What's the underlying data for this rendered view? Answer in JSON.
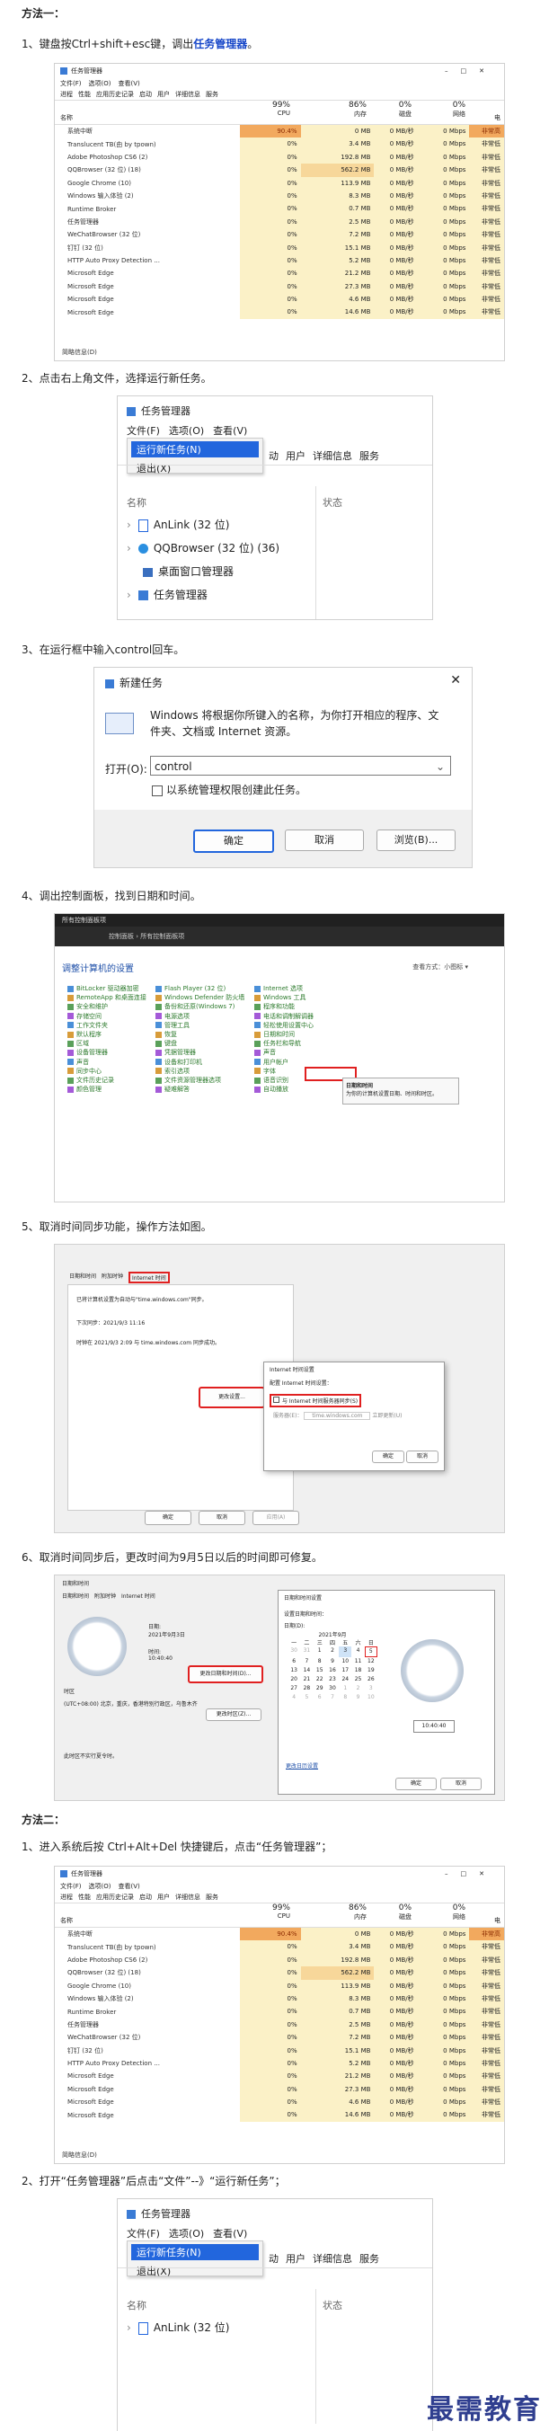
{
  "method1_title": "方法一：",
  "step1": {
    "prefix": "1、键盘按Ctrl+shift+esc键，调出",
    "highlight": "任务管理器",
    "suffix": "。"
  },
  "taskmgr": {
    "title": "任务管理器",
    "menu": [
      "文件(F)",
      "选项(O)",
      "查看(V)"
    ],
    "tabs": [
      "进程",
      "性能",
      "应用历史记录",
      "启动",
      "用户",
      "详细信息",
      "服务"
    ],
    "headers": {
      "name": "名称",
      "status": "状态",
      "cpu": "99%",
      "cpu_label": "CPU",
      "mem": "86%",
      "mem_label": "内存",
      "disk": "0%",
      "disk_label": "磁盘",
      "net": "0%",
      "net_label": "网络",
      "power_label": "电"
    },
    "rows": [
      {
        "name": "系统中断",
        "cpu": "90.4%",
        "mem": "0 MB",
        "disk": "0 MB/秒",
        "net": "0 Mbps",
        "power": "非常高",
        "hot": true
      },
      {
        "name": "Translucent TB(由 by tpown)",
        "cpu": "0%",
        "mem": "3.4 MB",
        "disk": "0 MB/秒",
        "net": "0 Mbps",
        "power": "非常低"
      },
      {
        "name": "Adobe Photoshop CS6 (2)",
        "cpu": "0%",
        "mem": "192.8 MB",
        "disk": "0 MB/秒",
        "net": "0 Mbps",
        "power": "非常低"
      },
      {
        "name": "QQBrowser (32 位) (18)",
        "cpu": "0%",
        "mem": "562.2 MB",
        "disk": "0 MB/秒",
        "net": "0 Mbps",
        "power": "非常低",
        "warm": true
      },
      {
        "name": "Google Chrome (10)",
        "cpu": "0%",
        "mem": "113.9 MB",
        "disk": "0 MB/秒",
        "net": "0 Mbps",
        "power": "非常低"
      },
      {
        "name": "Windows 输入体验 (2)",
        "cpu": "0%",
        "mem": "8.3 MB",
        "disk": "0 MB/秒",
        "net": "0 Mbps",
        "power": "非常低"
      },
      {
        "name": "Runtime Broker",
        "cpu": "0%",
        "mem": "0.7 MB",
        "disk": "0 MB/秒",
        "net": "0 Mbps",
        "power": "非常低"
      },
      {
        "name": "任务管理器",
        "cpu": "0%",
        "mem": "2.5 MB",
        "disk": "0 MB/秒",
        "net": "0 Mbps",
        "power": "非常低"
      },
      {
        "name": "WeChatBrowser (32 位)",
        "cpu": "0%",
        "mem": "7.2 MB",
        "disk": "0 MB/秒",
        "net": "0 Mbps",
        "power": "非常低"
      },
      {
        "name": "钉钉 (32 位)",
        "cpu": "0%",
        "mem": "15.1 MB",
        "disk": "0 MB/秒",
        "net": "0 Mbps",
        "power": "非常低"
      },
      {
        "name": "HTTP Auto Proxy Detection ...",
        "cpu": "0%",
        "mem": "5.2 MB",
        "disk": "0 MB/秒",
        "net": "0 Mbps",
        "power": "非常低"
      },
      {
        "name": "Microsoft Edge",
        "cpu": "0%",
        "mem": "21.2 MB",
        "disk": "0 MB/秒",
        "net": "0 Mbps",
        "power": "非常低"
      },
      {
        "name": "Microsoft Edge",
        "cpu": "0%",
        "mem": "27.3 MB",
        "disk": "0 MB/秒",
        "net": "0 Mbps",
        "power": "非常低"
      },
      {
        "name": "Microsoft Edge",
        "cpu": "0%",
        "mem": "4.6 MB",
        "disk": "0 MB/秒",
        "net": "0 Mbps",
        "power": "非常低"
      },
      {
        "name": "Microsoft Edge",
        "cpu": "0%",
        "mem": "14.6 MB",
        "disk": "0 MB/秒",
        "net": "0 Mbps",
        "power": "非常低"
      }
    ],
    "footer": "简略信息(D)"
  },
  "step2": "2、点击右上角文件，选择运行新任务。",
  "filemenu": {
    "title": "任务管理器",
    "menu": [
      "文件(F)",
      "选项(O)",
      "查看(V)"
    ],
    "run_new": "运行新任务(N)",
    "exit": "退出(X)",
    "tabs_tail": [
      "动",
      "用户",
      "详细信息",
      "服务"
    ],
    "col_name": "名称",
    "col_status": "状态",
    "items": [
      "AnLink (32 位)",
      "QQBrowser (32 位) (36)",
      "桌面窗口管理器",
      "任务管理器"
    ]
  },
  "step3": "3、在运行框中输入control回车。",
  "run": {
    "title": "新建任务",
    "desc_line1": "Windows 将根据你所键入的名称，为你打开相应的程序、文",
    "desc_line2": "件夹、文档或 Internet 资源。",
    "open_label": "打开(O):",
    "input_value": "control",
    "checkbox": "以系统管理权限创建此任务。",
    "ok": "确定",
    "cancel": "取消",
    "browse": "浏览(B)..."
  },
  "step4": "4、调出控制面板，找到日期和时间。",
  "cpanel": {
    "title": "所有控制面板项",
    "address": "控制面板 › 所有控制面板项",
    "heading": "调整计算机的设置",
    "view": "查看方式：小图标 ▾",
    "col1": [
      "BitLocker 驱动器加密",
      "RemoteApp 和桌面连接",
      "安全和维护",
      "存储空间",
      "工作文件夹",
      "默认程序",
      "区域",
      "设备管理器",
      "声音",
      "同步中心",
      "文件历史记录",
      "颜色管理"
    ],
    "col2": [
      "Flash Player (32 位)",
      "Windows Defender 防火墙",
      "备份和还原(Windows 7)",
      "电源选项",
      "管理工具",
      "恢复",
      "键盘",
      "凭据管理器",
      "设备和打印机",
      "索引选项",
      "文件资源管理器选项",
      "疑难解答"
    ],
    "col3": [
      "Internet 选项",
      "Windows 工具",
      "程序和功能",
      "电话和调制解调器",
      "轻松使用设置中心",
      "日期和时间",
      "任务栏和导航",
      "声音",
      "用户帐户",
      "字体",
      "语音识别",
      "自动播放"
    ],
    "tooltip_title": "日期和时间",
    "tooltip_desc": "为你的计算机设置日期、时间和时区。"
  },
  "step5": "5、取消时间同步功能，操作方法如图。",
  "inet": {
    "tabs": [
      "日期和时间",
      "附加时钟",
      "Internet 时间"
    ],
    "line1": "已将计算机设置为自动与\"time.windows.com\"同步。",
    "line2": "下次同步：2021/9/3 11:16",
    "line3": "时钟在 2021/9/3 2:09 与 time.windows.com 同步成功。",
    "change_btn": "更改设置...",
    "ok": "确定",
    "cancel": "取消",
    "apply": "应用(A)",
    "sub_title": "Internet 时间设置",
    "sub_heading": "配置 Internet 时间设置：",
    "sub_check": "与 Internet 时间服务器同步(S)",
    "sub_server_label": "服务器(E)：",
    "sub_server": "time.windows.com",
    "sub_update": "立即更新(U)",
    "sub_ok": "确定",
    "sub_cancel": "取消"
  },
  "step6": "6、取消时间同步后，更改时间为9月5日以后的时间即可修复。",
  "datetime": {
    "title": "日期和时间",
    "tabs": [
      "日期和时间",
      "附加时钟",
      "Internet 时间"
    ],
    "date_label": "日期:",
    "date": "2021年9月3日",
    "time_label": "时间:",
    "time": "10:40:40",
    "change_btn": "更改日期和时间(D)...",
    "tz_label": "时区",
    "tz": "(UTC+08:00) 北京，重庆，香港特别行政区，乌鲁木齐",
    "tz_btn": "更改时区(Z)...",
    "dst": "此时区不实行夏令时。",
    "sub_title": "日期和时间设置",
    "sub_heading": "设置日期和时间：",
    "sub_date_label": "日期(D):",
    "month": "2021年9月",
    "weekdays": [
      "一",
      "二",
      "三",
      "四",
      "五",
      "六",
      "日"
    ],
    "days": [
      "30",
      "31",
      "1",
      "2",
      "3",
      "4",
      "5",
      "6",
      "7",
      "8",
      "9",
      "10",
      "11",
      "12",
      "13",
      "14",
      "15",
      "16",
      "17",
      "18",
      "19",
      "20",
      "21",
      "22",
      "23",
      "24",
      "25",
      "26",
      "27",
      "28",
      "29",
      "30",
      "1",
      "2",
      "3",
      "4",
      "5",
      "6",
      "7",
      "8",
      "9",
      "10"
    ],
    "sub_time": "10:40:40",
    "link": "更改日历设置",
    "sub_ok": "确定",
    "sub_cancel": "取消"
  },
  "method2_title": "方法二：",
  "m2_step1": "1、进入系统后按 Ctrl+Alt+Del 快捷键后，点击“任务管理器”；",
  "m2_step2": "2、打开“任务管理器”后点击“文件”--》“运行新任务”；",
  "watermark": "最需教育"
}
